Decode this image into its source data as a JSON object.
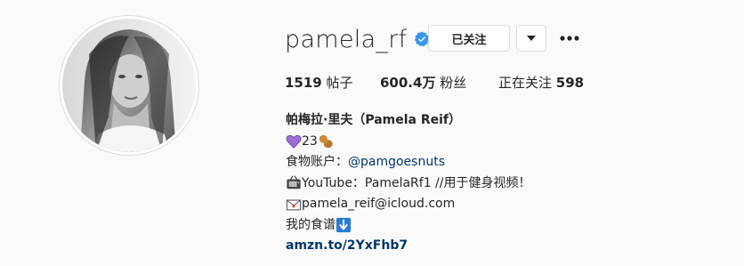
{
  "profile": {
    "username": "pamela_rf",
    "verified": true,
    "follow_button": "已关注",
    "dropdown_icon": "chevron-down-icon",
    "more_icon": "more-options-icon"
  },
  "stats": {
    "posts_count": "1519",
    "posts_label": "帖子",
    "followers_count": "600.4万",
    "followers_label": "粉丝",
    "following_label": "正在关注",
    "following_count": "598"
  },
  "bio": {
    "full_name": "帕梅拉·里夫（Pamela Reif）",
    "line_age_text": "23",
    "food_label": "食物账户：",
    "food_mention": "@pamgoesnuts",
    "youtube_text": "YouTube：PamelaRf1 //用于健身视频！",
    "email_text": "pamela_reif@icloud.com",
    "recipes_text": "我的食谱",
    "external_link": "amzn.to/2YxFhb7"
  },
  "colors": {
    "verified_blue": "#3897f0",
    "link_blue": "#00376b",
    "border": "#dbdbdb",
    "background": "#fafafa"
  }
}
